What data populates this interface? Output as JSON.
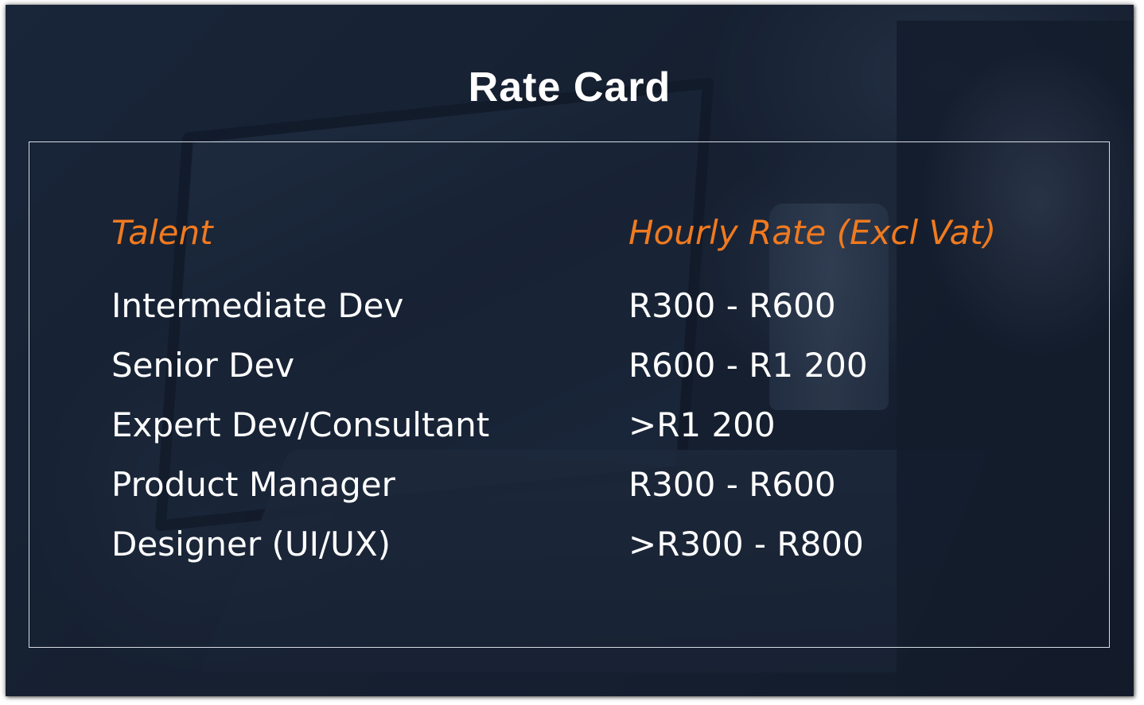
{
  "title": "Rate Card",
  "headers": {
    "talent": "Talent",
    "rate": "Hourly Rate (Excl Vat)"
  },
  "rows": [
    {
      "talent": "Intermediate Dev",
      "rate": "R300 - R600"
    },
    {
      "talent": "Senior Dev",
      "rate": "R600 - R1 200"
    },
    {
      "talent": "Expert Dev/Consultant",
      "rate": ">R1 200"
    },
    {
      "talent": "Product Manager",
      "rate": "R300 - R600"
    },
    {
      "talent": "Designer (UI/UX)",
      "rate": ">R300 - R800"
    }
  ],
  "colors": {
    "accent": "#f07a1f",
    "text": "#ffffff",
    "background": "#1a2536"
  }
}
